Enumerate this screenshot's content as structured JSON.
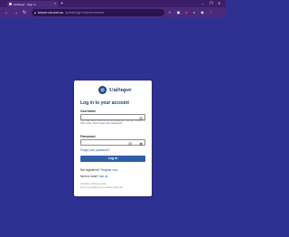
{
  "browser": {
    "tab_title": "UniSuper - Sign In",
    "new_tab": "+",
    "url_host": "secure.usi.com.au",
    "url_path": "/portal/login?client=member",
    "window_controls": [
      "–",
      "❐",
      "✕"
    ]
  },
  "card": {
    "brand": "UniSuper",
    "heading": "Log in to your account",
    "username_label": "Username",
    "username_value": "",
    "hint_text": "Your username could be an email address, member number or other value.",
    "hint_link": "Don't know your username?",
    "password_label": "Password",
    "password_value": "",
    "forgot_password": "Forgot your password?",
    "login_button": "Log in",
    "register_prompt": "Not registered?",
    "register_link": "Register now",
    "need_help_prompt": "Need a hand?",
    "need_help_link": "Ask us",
    "footer_line1": "Contact us  Privacy policy",
    "footer_line2": "Terms & conditions of member portal use"
  },
  "colors": {
    "page_bg": "#2e3192",
    "browser_chrome": "#4b2a7c",
    "accent": "#2f5ea8",
    "brand": "#1f3a6b"
  }
}
